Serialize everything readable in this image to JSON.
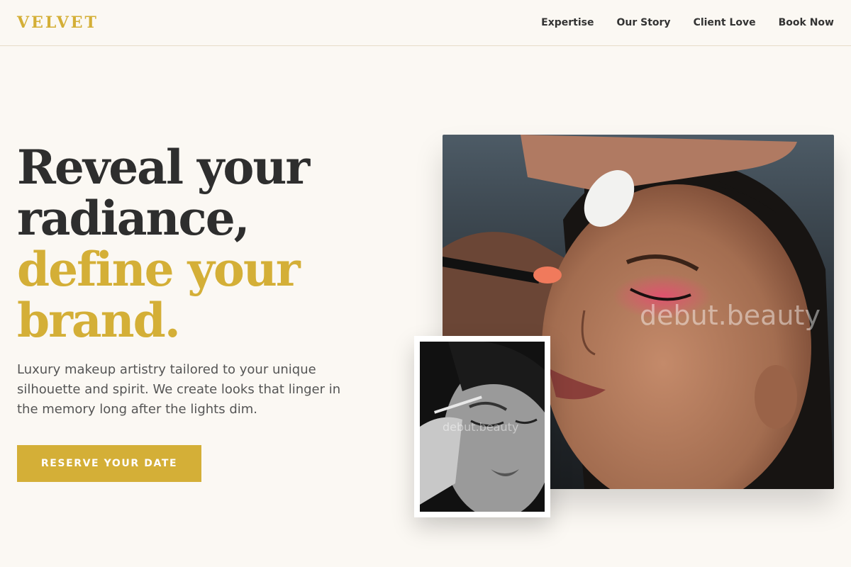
{
  "brand": {
    "logo": "VELVET",
    "accent_color": "#d4af37",
    "text_color": "#2e2e2e",
    "background_color": "#fbf8f3"
  },
  "nav": {
    "items": [
      {
        "label": "Expertise"
      },
      {
        "label": "Our Story"
      },
      {
        "label": "Client Love"
      },
      {
        "label": "Book Now"
      }
    ]
  },
  "hero": {
    "heading_line1": "Reveal your",
    "heading_line2": "radiance,",
    "heading_accent_line1": "define your",
    "heading_accent_line2": "brand.",
    "subtitle": "Luxury makeup artistry tailored to your unique silhouette and spirit. We create looks that linger in the memory long after the lights dim.",
    "cta_label": "RESERVE YOUR DATE"
  },
  "images": {
    "main_watermark": "debut.beauty",
    "inset_watermark": "debut.beauty",
    "main_icon": "makeup-application-photo",
    "inset_icon": "black-white-eyeliner-photo"
  }
}
